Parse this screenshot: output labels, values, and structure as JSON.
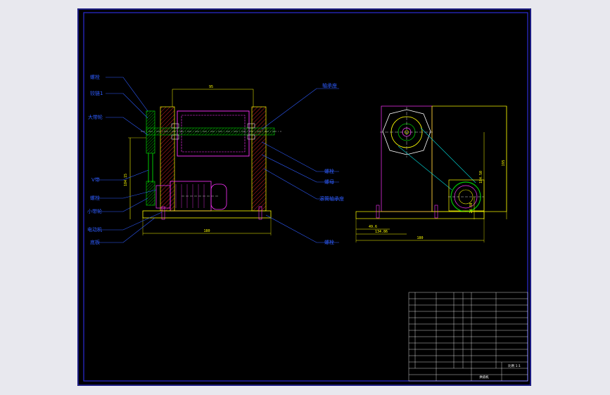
{
  "colors": {
    "background": "#000000",
    "frame": "#2b2bd6",
    "outline": "#ffff00",
    "callout": "#2e5cff",
    "hatch": "#d02020",
    "motor": "#ff33ff",
    "green": "#00c800",
    "cyan": "#00c8c8",
    "white": "#ffffff"
  },
  "front_view": {
    "labels_left": [
      "螺栓",
      "铰链1",
      "大带轮",
      "V带",
      "螺栓",
      "小带轮",
      "电动机",
      "底板"
    ],
    "labels_right": [
      "轴承座",
      "螺栓",
      "螺母",
      "滚筒轴承座",
      "螺栓"
    ],
    "dimensions": {
      "top_width": "95",
      "height": "184.15",
      "base_length": "180"
    }
  },
  "side_view": {
    "dimensions": {
      "height_total": "195",
      "height_right": "184.50",
      "small_height": "24.50",
      "offset_a": "49.6",
      "offset_b": "134.86",
      "base": "180"
    }
  },
  "title_block": {
    "drawing_name": "烘焙机",
    "scale_label": "比例 1:1"
  }
}
